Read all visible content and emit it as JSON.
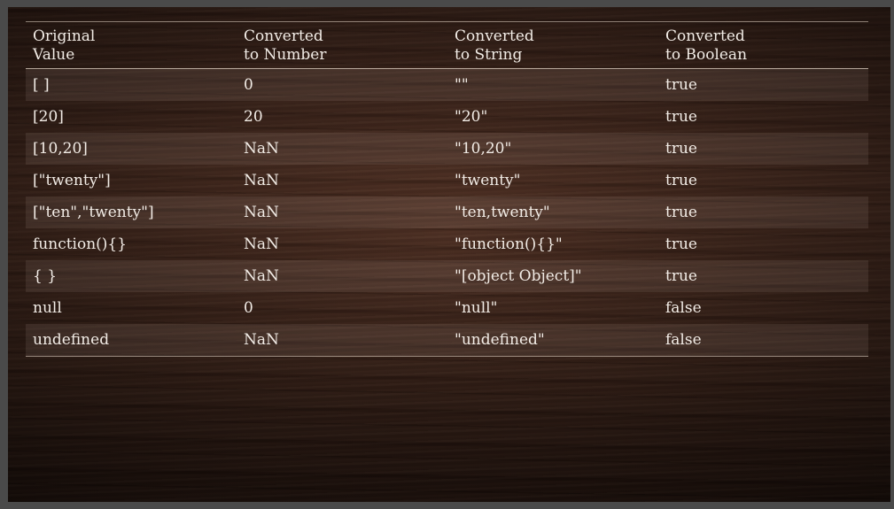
{
  "table": {
    "headers": [
      [
        "Original",
        "Value"
      ],
      [
        "Converted",
        "to Number"
      ],
      [
        "Converted",
        "to String"
      ],
      [
        "Converted",
        "to Boolean"
      ]
    ],
    "rows": [
      [
        "[ ]",
        "0",
        "\"\"",
        "true"
      ],
      [
        "[20]",
        "20",
        "\"20\"",
        "true"
      ],
      [
        "[10,20]",
        "NaN",
        "\"10,20\"",
        "true"
      ],
      [
        "[\"twenty\"]",
        "NaN",
        "\"twenty\"",
        "true"
      ],
      [
        "[\"ten\",\"twenty\"]",
        "NaN",
        "\"ten,twenty\"",
        "true"
      ],
      [
        "function(){}",
        "NaN",
        "\"function(){}\"",
        "true"
      ],
      [
        "{ }",
        "NaN",
        "\"[object Object]\"",
        "true"
      ],
      [
        "null",
        "0",
        "\"null\"",
        "false"
      ],
      [
        "undefined",
        "NaN",
        "\"undefined\"",
        "false"
      ]
    ]
  }
}
